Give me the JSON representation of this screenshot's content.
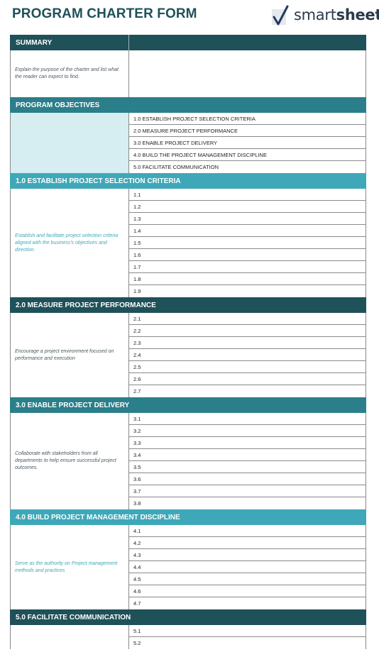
{
  "title": "PROGRAM CHARTER FORM",
  "logo": {
    "icon": "checkmark-icon",
    "text_regular": "smart",
    "text_bold": "sheet"
  },
  "colors": {
    "dark_header": "#1f5159",
    "mid_header": "#2a7f8a",
    "light_header": "#3ea8b9",
    "objectives_fill": "#d6edf1"
  },
  "summary": {
    "header": "SUMMARY",
    "description": "Explain the purpose of the charter and list what the reader can expect to find."
  },
  "objectives": {
    "header": "PROGRAM OBJECTIVES",
    "items": [
      "1.0 ESTABLISH PROJECT SELECTION CRITERIA",
      "2.0 MEASURE PROJECT PERFORMANCE",
      "3.0 ENABLE PROJECT DELIVERY",
      "4.0 BUILD THE PROJECT MANAGEMENT DISCIPLINE",
      "5.0 FACILITATE COMMUNICATION"
    ]
  },
  "sections": [
    {
      "header": "1.0 ESTABLISH PROJECT SELECTION CRITERIA",
      "description": "Establish and facilitate project selection criteria aligned with the business's objectives and direction.",
      "rows": [
        "1.1",
        "1.2",
        "1.3",
        "1.4",
        "1.5",
        "1.6",
        "1.7",
        "1.8",
        "1.9"
      ]
    },
    {
      "header": "2.0 MEASURE PROJECT PERFORMANCE",
      "description": "Encourage a project environment focused on performance and execution",
      "rows": [
        "2.1",
        "2.2",
        "2.3",
        "2.4",
        "2.5",
        "2.6",
        "2.7"
      ]
    },
    {
      "header": "3.0 ENABLE PROJECT DELIVERY",
      "description": "Collaborate with stakeholders from all departments to help ensure successful project outcomes.",
      "rows": [
        "3.1",
        "3.2",
        "3.3",
        "3.4",
        "3.5",
        "3.6",
        "3.7",
        "3.8"
      ]
    },
    {
      "header": "4.0 BUILD PROJECT MANAGEMENT DISCIPLINE",
      "description": "Serve as the authority on Project management methods and practices",
      "rows": [
        "4.1",
        "4.2",
        "4.3",
        "4.4",
        "4.5",
        "4.6",
        "4.7"
      ]
    },
    {
      "header": "5.0 FACILITATE COMMUNICATION",
      "description": "",
      "rows": [
        "5.1",
        "5.2"
      ]
    }
  ]
}
